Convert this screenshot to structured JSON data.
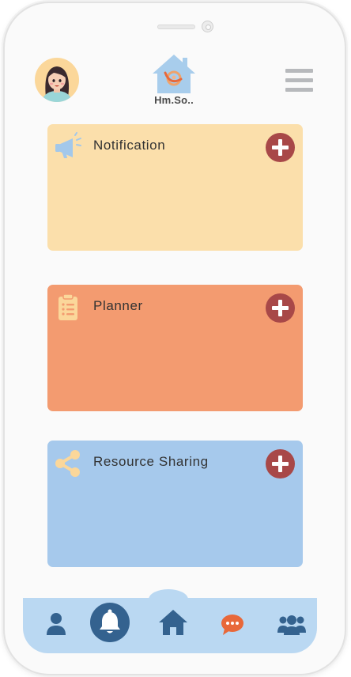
{
  "app": {
    "logo_text": "Hm.So.."
  },
  "header": {
    "avatar": "user-avatar",
    "menu_icon": "hamburger-menu-icon"
  },
  "cards": [
    {
      "title": "Notification",
      "icon": "megaphone-icon",
      "color": "#fbdfab",
      "icon_color": "#a3c8ea",
      "action_icon": "plus-circle-icon"
    },
    {
      "title": "Planner",
      "icon": "clipboard-list-icon",
      "color": "#f39b70",
      "icon_color": "#fbd79a",
      "action_icon": "plus-circle-icon"
    },
    {
      "title": "Resource Sharing",
      "icon": "share-icon",
      "color": "#a6c9ec",
      "icon_color": "#fbd79a",
      "action_icon": "plus-circle-icon"
    }
  ],
  "tabbar": {
    "items": [
      {
        "name": "profile",
        "icon": "user-icon"
      },
      {
        "name": "notifications",
        "icon": "bell-icon",
        "active": true
      },
      {
        "name": "home",
        "icon": "home-icon"
      },
      {
        "name": "chat",
        "icon": "chat-bubble-icon"
      },
      {
        "name": "community",
        "icon": "users-icon"
      }
    ]
  },
  "colors": {
    "accent_dark_blue": "#34628f",
    "add_button": "#a84848",
    "tabbar_bg": "#bad8f2",
    "chat_orange": "#e8683a"
  }
}
